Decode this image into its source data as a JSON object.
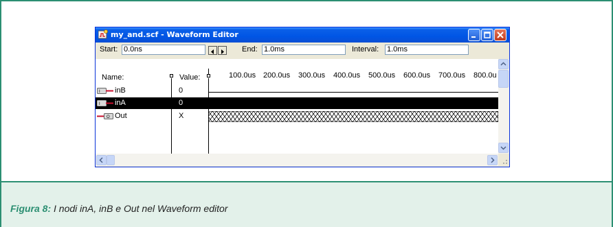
{
  "window": {
    "title": "my_and.scf - Waveform Editor",
    "buttons": {
      "minimize": "minimize",
      "maximize": "maximize",
      "close": "close"
    }
  },
  "toolbar": {
    "start_label": "Start:",
    "start_value": "0.0ns",
    "end_label": "End:",
    "end_value": "1.0ms",
    "interval_label": "Interval:",
    "interval_value": "1.0ms"
  },
  "columns": {
    "name": "Name:",
    "value": "Value:"
  },
  "timeline": {
    "ticks": [
      "100.0us",
      "200.0us",
      "300.0us",
      "400.0us",
      "500.0us",
      "600.0us",
      "700.0us",
      "800.0u"
    ]
  },
  "nodes": [
    {
      "name": "inB",
      "value": "0",
      "selected": false,
      "kind": "input",
      "wave": "low"
    },
    {
      "name": "inA",
      "value": "0",
      "selected": true,
      "kind": "input",
      "wave": "low"
    },
    {
      "name": "Out",
      "value": "X",
      "selected": false,
      "kind": "output",
      "wave": "unknown"
    }
  ],
  "caption": {
    "label": "Figura 8:",
    "text": "I nodi inA, inB e Out nel Waveform editor"
  },
  "colors": {
    "frame": "#2c8f72",
    "caption_bg": "#e3f1ea",
    "titlebar": "#0055e5"
  }
}
